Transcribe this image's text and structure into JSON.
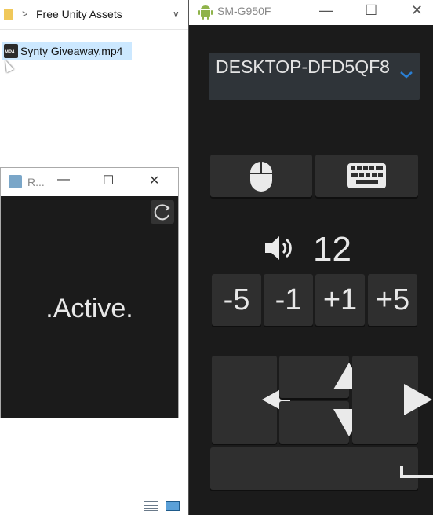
{
  "explorer": {
    "breadcrumb_sep": ">",
    "breadcrumb": "Free Unity Assets",
    "file_name": "Synty Giveaway.mp4"
  },
  "small_window": {
    "title": "R...",
    "minimize": "—",
    "maximize": "☐",
    "close": "✕",
    "status": ".Active."
  },
  "remote_window": {
    "title": "SM-G950F",
    "minimize": "—",
    "maximize": "☐",
    "close": "✕",
    "device": "DESKTOP-DFD5QF8",
    "volume": "12",
    "volume_buttons": [
      "-5",
      "-1",
      "+1",
      "+5"
    ],
    "colors": {
      "background": "#1b1b1b",
      "button": "#2f2f2f",
      "accent": "#2a7fd4"
    }
  },
  "icons": [
    "folder-icon",
    "mp4-file-icon",
    "refresh-icon",
    "android-icon",
    "mouse-icon",
    "keyboard-icon",
    "speaker-icon",
    "arrow-left-icon",
    "arrow-up-icon",
    "arrow-down-icon",
    "arrow-right-icon",
    "space-icon",
    "details-view-icon",
    "thumbnail-view-icon"
  ]
}
